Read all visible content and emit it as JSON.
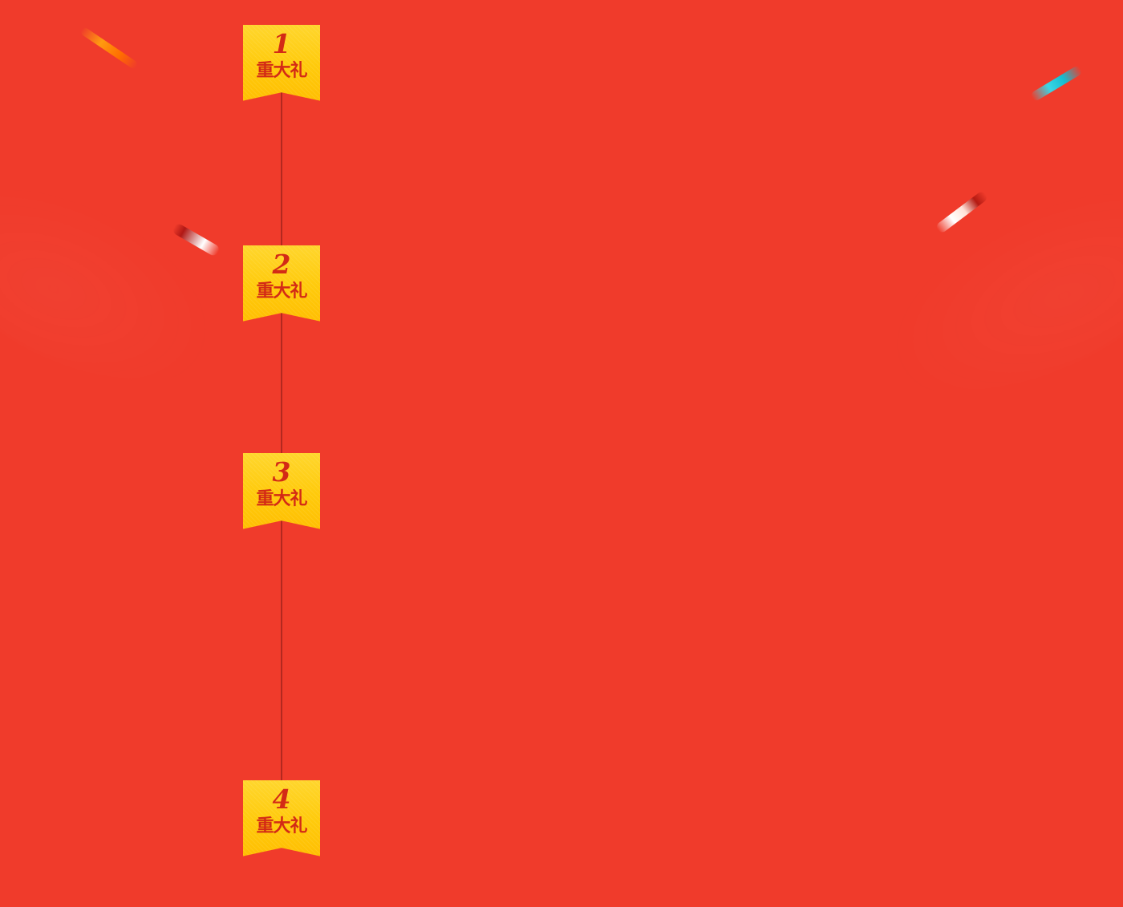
{
  "colors": {
    "background": "#f03b2b",
    "badge_fill": "#ffca0b",
    "badge_text": "#d32a16",
    "timeline": "#b3281f"
  },
  "badges": [
    {
      "number": "1",
      "label": "重大礼"
    },
    {
      "number": "2",
      "label": "重大礼"
    },
    {
      "number": "3",
      "label": "重大礼"
    },
    {
      "number": "4",
      "label": "重大礼"
    }
  ],
  "decorations": {
    "confetti": [
      {
        "name": "orange-confetti",
        "color": "#ff9b10"
      },
      {
        "name": "cyan-confetti",
        "color": "#39d6e5"
      },
      {
        "name": "white-red-confetti-left",
        "color": "#ffffff"
      },
      {
        "name": "white-red-confetti-right",
        "color": "#ffffff"
      }
    ]
  }
}
